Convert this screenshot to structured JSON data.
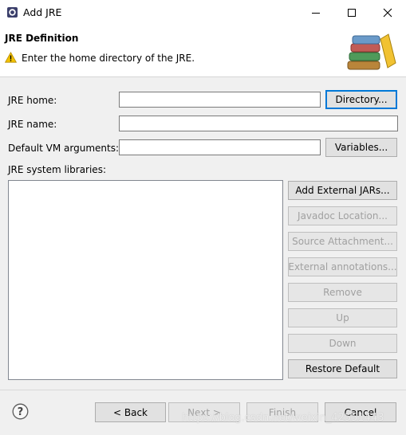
{
  "window": {
    "title": "Add JRE"
  },
  "header": {
    "title": "JRE Definition",
    "message": "Enter the home directory of the JRE."
  },
  "form": {
    "jre_home": {
      "label": "JRE home:",
      "value": ""
    },
    "jre_name": {
      "label": "JRE name:",
      "value": ""
    },
    "vm_args": {
      "label": "Default VM arguments:",
      "value": ""
    },
    "directory_button": "Directory...",
    "variables_button": "Variables..."
  },
  "libraries": {
    "label": "JRE system libraries:",
    "buttons": {
      "add_external_jars": {
        "label": "Add External JARs...",
        "enabled": true
      },
      "javadoc_location": {
        "label": "Javadoc Location...",
        "enabled": false
      },
      "source_attachment": {
        "label": "Source Attachment...",
        "enabled": false
      },
      "external_annotations": {
        "label": "External annotations...",
        "enabled": false
      },
      "remove": {
        "label": "Remove",
        "enabled": false
      },
      "up": {
        "label": "Up",
        "enabled": false
      },
      "down": {
        "label": "Down",
        "enabled": false
      },
      "restore_default": {
        "label": "Restore Default",
        "enabled": true
      }
    }
  },
  "footer": {
    "back": {
      "label": "< Back",
      "enabled": true
    },
    "next": {
      "label": "Next >",
      "enabled": false
    },
    "finish": {
      "label": "Finish",
      "enabled": false
    },
    "cancel": {
      "label": "Cancel",
      "enabled": true
    },
    "watermark": "https://blog.csdn.net/weixin_42551443"
  },
  "icons": {
    "app": "eclipse-icon",
    "warning": "warning-icon",
    "banner": "books-icon",
    "help": "help-icon"
  },
  "colors": {
    "focus_border": "#0078d7",
    "disabled_text": "#a0a0a0",
    "warning_yellow": "#f2c200"
  }
}
